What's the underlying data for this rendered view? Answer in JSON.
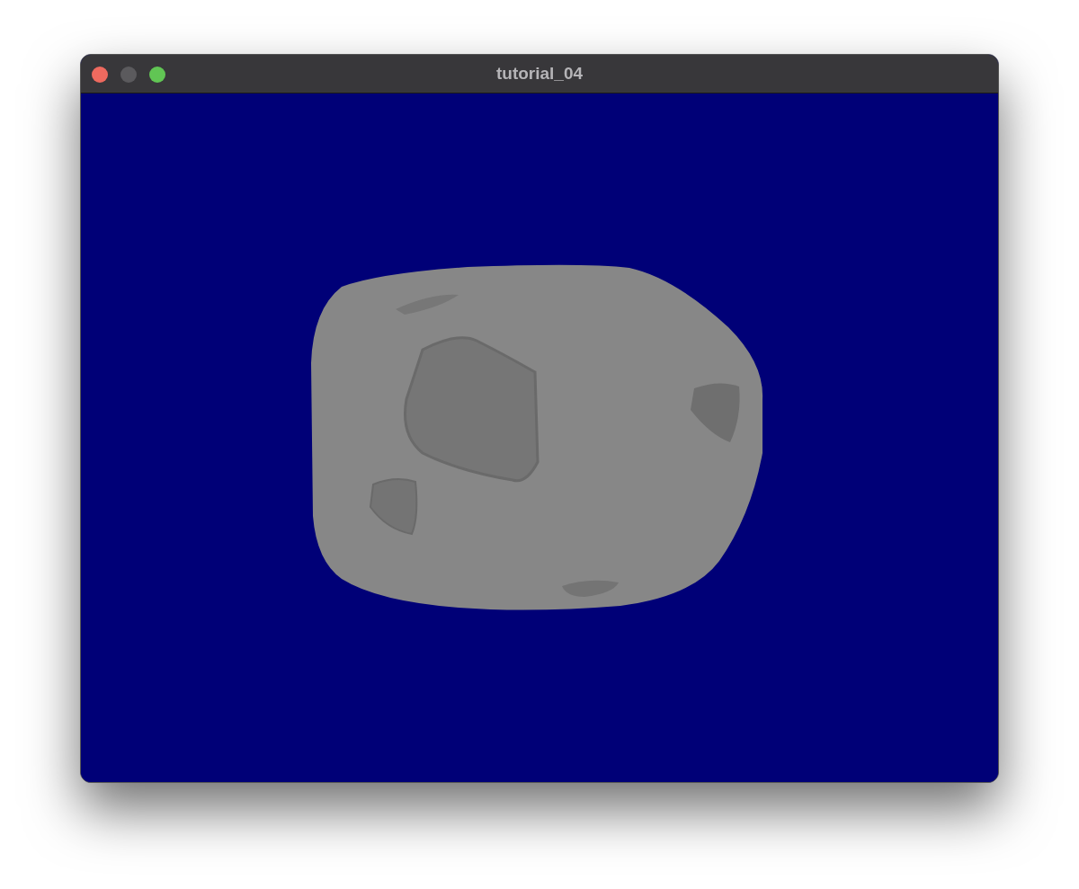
{
  "window": {
    "title": "tutorial_04",
    "buttons": [
      {
        "kind": "close",
        "disabled": false
      },
      {
        "kind": "minimize",
        "disabled": true
      },
      {
        "kind": "zoom",
        "disabled": false
      }
    ]
  }
}
